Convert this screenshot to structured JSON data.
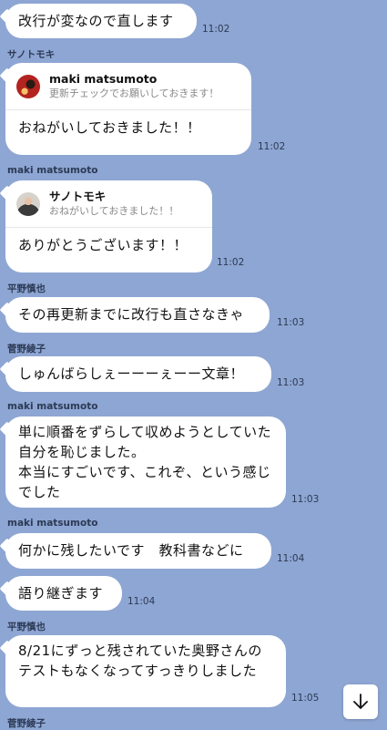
{
  "messages": [
    {
      "sender": "",
      "text": "改行が変なので直します",
      "time": "11:02"
    },
    {
      "sender": "サノトモキ",
      "reply_to_name": "maki matsumoto",
      "reply_to_text": "更新チェックでお願いしておきます！",
      "text": "おねがいしておきました！！",
      "time": "11:02"
    },
    {
      "sender": "maki matsumoto",
      "reply_to_name": "サノトモキ",
      "reply_to_text": "おねがいしておきました！！",
      "text": "ありがとうございます！！",
      "time": "11:02"
    },
    {
      "sender": "平野慎也",
      "text": "その再更新までに改行も直さなきゃ",
      "time": "11:03"
    },
    {
      "sender": "菅野綾子",
      "text": "しゅんばらしぇーーーぇーー文章！",
      "time": "11:03"
    },
    {
      "sender": "maki matsumoto",
      "text": "単に順番をずらして収めようとしていた自分を恥じました。\n本当にすごいです、これぞ、という感じでした",
      "time": "11:03"
    },
    {
      "sender": "maki matsumoto",
      "text": "何かに残したいです　教科書などに",
      "time": "11:04"
    },
    {
      "sender": "",
      "text": "語り継ぎます",
      "time": "11:04"
    },
    {
      "sender": "平野慎也",
      "text": "8/21にずっと残されていた奥野さんのテストもなくなってすっきりしました",
      "time": "11:05"
    },
    {
      "sender": "菅野綾子",
      "text": "",
      "time": ""
    }
  ],
  "controls": {
    "scroll_down_icon": "arrow-down-icon"
  },
  "colors": {
    "background": "#8ea6d3",
    "bubble": "#ffffff"
  }
}
